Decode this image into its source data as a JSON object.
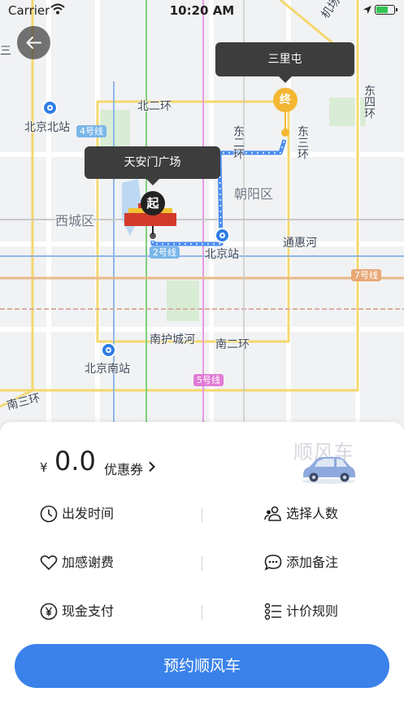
{
  "status_bar": {
    "carrier": "Carrier",
    "time": "10:20 AM"
  },
  "map": {
    "labels": {
      "sanhuan_nw": "三",
      "airport_expressway": "机场高速",
      "dongsihuan": "东四环",
      "beierhuan": "北二环",
      "beijingbeizhan": "北京北站",
      "line4": "4号线",
      "dongerhuan": "东二环",
      "dongsanhuan": "东三环",
      "chaoyangqu": "朝阳区",
      "xichengqu": "西城区",
      "line2": "2号线",
      "beijingzhan": "北京站",
      "tonghuihe": "通惠河",
      "line7": "7号线",
      "nanhuchengh": "南护城河",
      "nanerhuan": "南二环",
      "beijingnanzhan": "北京南站",
      "line5": "5号线",
      "nansanhuan": "南三环"
    },
    "start": {
      "name": "天安门广场",
      "pin": "起"
    },
    "end": {
      "name": "三里屯",
      "pin": "终"
    }
  },
  "panel": {
    "currency": "¥",
    "price": "0.0",
    "coupon_label": "优惠券",
    "service_title": "顺风车",
    "options": {
      "departure_time": "出发时间",
      "passengers": "选择人数",
      "thanks_fee": "加感谢费",
      "note": "添加备注",
      "payment": "现金支付",
      "pricing_rules": "计价规则"
    },
    "cta": "预约顺风车"
  },
  "colors": {
    "accent": "#3a82ea",
    "route": "#4a8cf0",
    "end_pin": "#f4b733",
    "bubble": "#3d3d3d"
  }
}
